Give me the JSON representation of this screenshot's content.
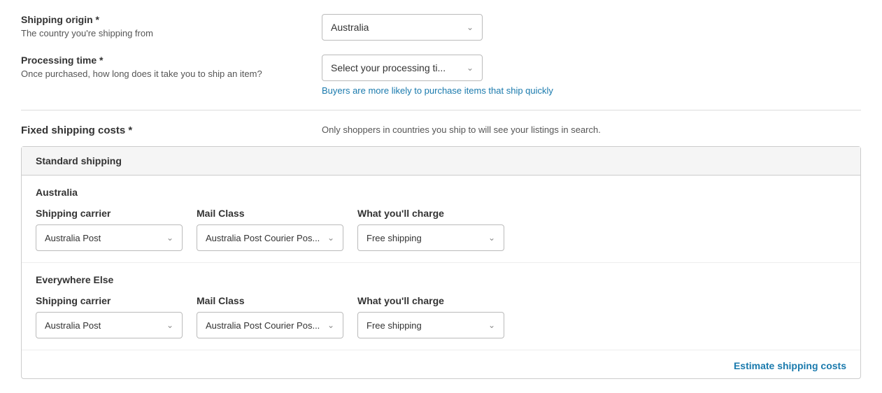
{
  "shipping_origin": {
    "label": "Shipping origin *",
    "sublabel": "The country you're shipping from",
    "dropdown_value": "Australia"
  },
  "processing_time": {
    "label": "Processing time *",
    "sublabel_part1": "Once purchased, how long does it take you to ship an item?",
    "dropdown_placeholder": "Select your processing ti...",
    "hint": "Buyers are more likely to purchase items that ship quickly"
  },
  "fixed_shipping": {
    "label": "Fixed shipping costs *",
    "note": "Only shoppers in countries you ship to will see your listings in search.",
    "table": {
      "section_title": "Standard shipping",
      "rows": [
        {
          "region": "Australia",
          "shipping_carrier_label": "Shipping carrier",
          "shipping_carrier_value": "Australia Post",
          "mail_class_label": "Mail Class",
          "mail_class_value": "Australia Post Courier Pos...",
          "charge_label": "What you'll charge",
          "charge_value": "Free shipping"
        },
        {
          "region": "Everywhere Else",
          "shipping_carrier_label": "Shipping carrier",
          "shipping_carrier_value": "Australia Post",
          "mail_class_label": "Mail Class",
          "mail_class_value": "Australia Post Courier Pos...",
          "charge_label": "What you'll charge",
          "charge_value": "Free shipping"
        }
      ]
    }
  },
  "estimate_link": "Estimate shipping costs",
  "icons": {
    "chevron": "&#8964;"
  }
}
